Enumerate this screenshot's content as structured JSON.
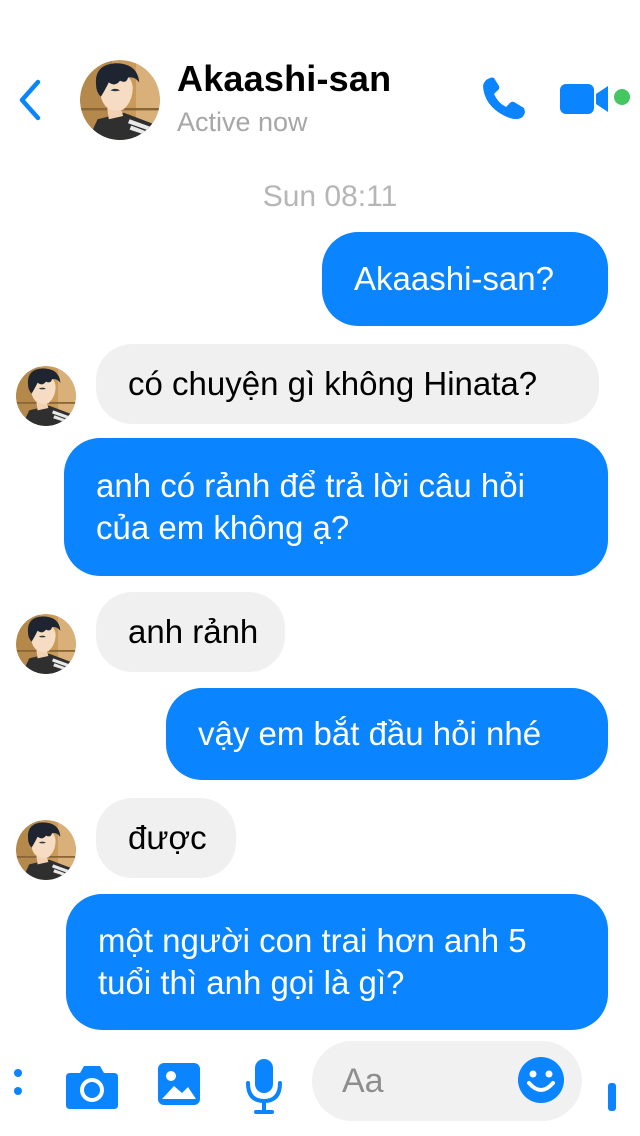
{
  "header": {
    "contact_name": "Akaashi-san",
    "status": "Active now",
    "accent_color": "#0a84ff",
    "online_color": "#44c660"
  },
  "icons": {
    "back": "chevron-left-icon",
    "call": "phone-icon",
    "video": "video-camera-icon",
    "more": "more-options-icon",
    "camera": "camera-icon",
    "photo": "photo-gallery-icon",
    "mic": "microphone-icon",
    "emoji": "emoji-icon",
    "like": "like-icon"
  },
  "conversation": {
    "timestamp": "Sun 08:11",
    "messages": [
      {
        "from": "me",
        "text": "Akaashi-san?"
      },
      {
        "from": "them",
        "text": "có chuyện gì không Hinata?"
      },
      {
        "from": "me",
        "lines": [
          "anh có rảnh để trả lời câu hỏi",
          "của em không ạ?"
        ]
      },
      {
        "from": "them",
        "text": "anh rảnh"
      },
      {
        "from": "me",
        "text": "vậy em bắt đầu hỏi nhé"
      },
      {
        "from": "them",
        "text": "được"
      },
      {
        "from": "me",
        "lines": [
          "một người con trai hơn anh 5",
          "tuổi thì anh gọi là gì?"
        ]
      }
    ]
  },
  "composer": {
    "placeholder": "Aa"
  }
}
